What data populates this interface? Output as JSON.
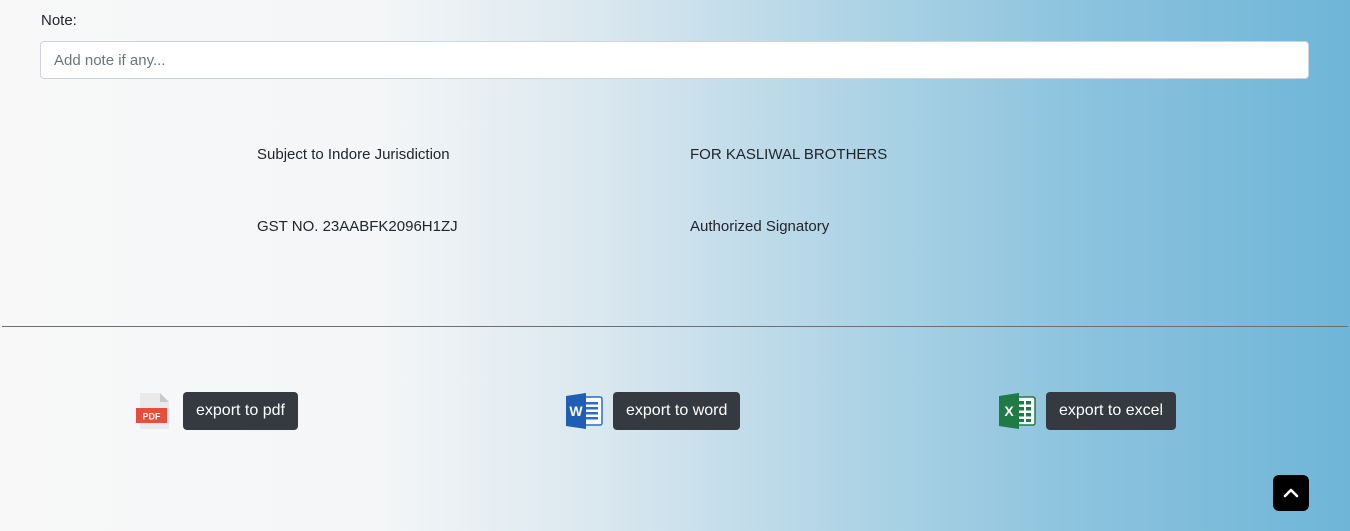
{
  "note": {
    "label": "Note:",
    "placeholder": "Add note if any...",
    "value": ""
  },
  "footer": {
    "jurisdiction": "Subject to Indore Jurisdiction",
    "firm": "FOR KASLIWAL BROTHERS",
    "gst": "GST NO. 23AABFK2096H1ZJ",
    "signatory": "Authorized Signatory"
  },
  "exports": {
    "pdf": {
      "label": "export to pdf",
      "icon": "pdf-file-icon",
      "icon_text": "PDF",
      "color": "#e74c3c"
    },
    "word": {
      "label": "export to word",
      "icon": "word-icon",
      "icon_text": "W",
      "color": "#1e5fb3"
    },
    "excel": {
      "label": "export to excel",
      "icon": "excel-icon",
      "icon_text": "X",
      "color": "#1f7a45"
    }
  },
  "scroll_top": {
    "icon": "chevron-up-icon"
  }
}
